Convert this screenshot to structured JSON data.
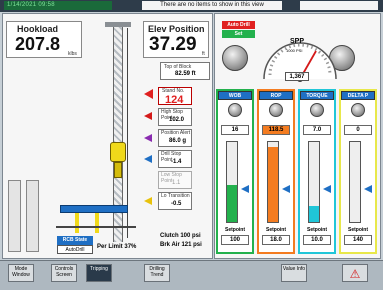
{
  "header": {
    "top_left": "1/14/2021  09:58",
    "message": "There are no items to show in this view"
  },
  "hookload": {
    "label": "Hookload",
    "value": "207.8",
    "unit": "klbs"
  },
  "elev": {
    "label": "Elev Position",
    "value": "37.29",
    "unit": "ft"
  },
  "topofblock": {
    "label": "Top of Block",
    "value": "82.59 ft"
  },
  "stand": {
    "label": "Stand No.",
    "value": "124"
  },
  "high_stop": {
    "label": "High Stop Point",
    "value": "102.0"
  },
  "position_alert": {
    "label": "Position Alert",
    "value": "86.0 g"
  },
  "drill_stop": {
    "label": "Drill Stop Point",
    "value": "-1.4"
  },
  "low_stop": {
    "label": "Low Stop Point",
    "value": "1.1"
  },
  "low_transition": {
    "label": "Lo Transition",
    "value": "-0.5"
  },
  "clutch": {
    "label": "Clutch",
    "value": "100 psi"
  },
  "brk_air": {
    "label": "Brk Air",
    "value": "121 psi"
  },
  "rcb": {
    "label": "RCB State",
    "mode": "AutoDrill",
    "perlimit": "Per Limit",
    "perlimit_pct": "37%"
  },
  "auto_drill": {
    "label": "Auto Drill",
    "state": "Set"
  },
  "spp": {
    "label": "SPP",
    "sub": "1000 PSI",
    "value": "1,367"
  },
  "columns": [
    {
      "head": "WOB",
      "value": "16",
      "setpoint_label": "Setpoint",
      "setpoint": "100",
      "color": "#23b14d",
      "fill": 0.45
    },
    {
      "head": "ROP",
      "value": "118.5",
      "setpoint_label": "Setpoint",
      "setpoint": "18.0",
      "color": "#f47c20",
      "fill": 0.92
    },
    {
      "head": "TORQUE",
      "value": "7.0",
      "setpoint_label": "Setpoint",
      "setpoint": "10.0",
      "color": "#20c6d8",
      "fill": 0.2
    },
    {
      "head": "DELTA P",
      "value": "0",
      "setpoint_label": "Setpoint",
      "setpoint": "140",
      "color": "#e8e84a",
      "fill": 0.0
    }
  ],
  "bottom_buttons": [
    "Mode Window",
    "Controls Screen",
    "Tripping",
    "Drilling Trend",
    "Value Info",
    ""
  ],
  "colors": {
    "accent": "#1f6fc4",
    "alarm_red": "#e02020"
  }
}
